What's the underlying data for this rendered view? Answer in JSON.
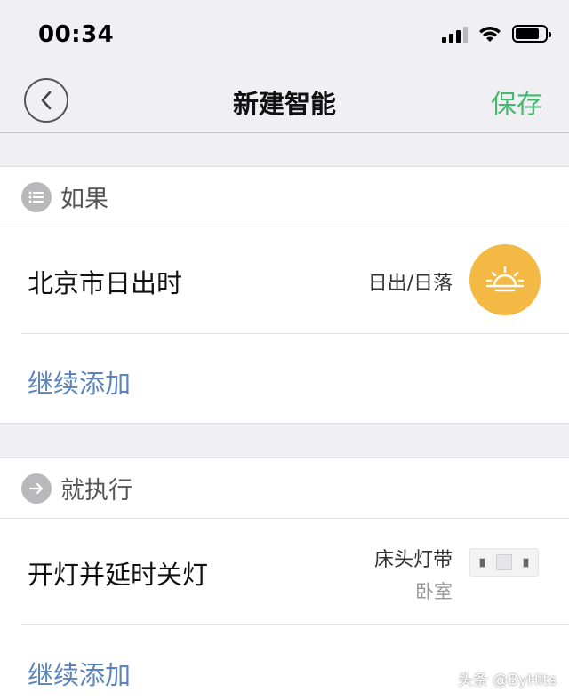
{
  "status_bar": {
    "time": "00:34"
  },
  "nav": {
    "title": "新建智能",
    "save_label": "保存"
  },
  "if_section": {
    "header": "如果",
    "condition": {
      "title": "北京市日出时",
      "label": "日出/日落"
    },
    "add_label": "继续添加"
  },
  "then_section": {
    "header": "就执行",
    "action": {
      "title": "开灯并延时关灯",
      "device": "床头灯带",
      "room": "卧室"
    },
    "add_label": "继续添加"
  },
  "colors": {
    "save": "#43b96e",
    "link": "#5b83bd",
    "sun_badge": "#f3b944"
  },
  "watermark": "头条 @ByHits"
}
